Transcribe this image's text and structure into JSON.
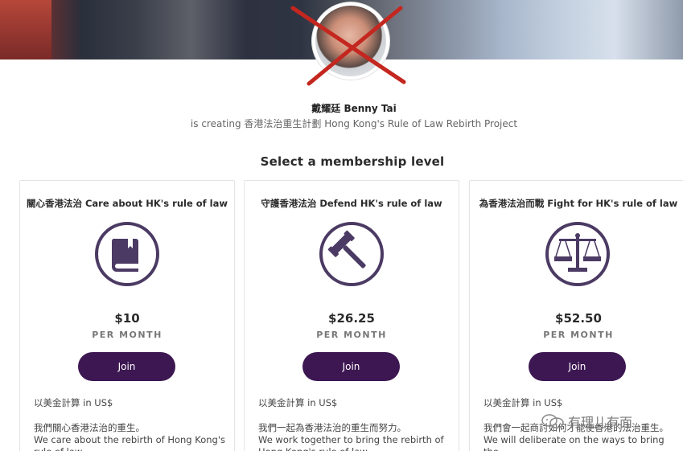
{
  "creator": {
    "name": "戴耀廷 Benny Tai",
    "creating_line": "is creating 香港法治重生計劃 Hong Kong's Rule of Law Rebirth Project"
  },
  "section_title": "Select a membership level",
  "tiers": [
    {
      "title": "關心香港法治 Care about HK's rule of law",
      "icon": "book-icon",
      "price": "$10",
      "period": "PER MONTH",
      "join_label": "Join",
      "currency_note": "以美金計算 in US$",
      "desc_zh": "我們關心香港法治的重生。",
      "desc_en": "We care about the rebirth of Hong Kong's rule of law"
    },
    {
      "title": "守護香港法治 Defend HK's rule of law",
      "icon": "gavel-icon",
      "price": "$26.25",
      "period": "PER MONTH",
      "join_label": "Join",
      "currency_note": "以美金計算 in US$",
      "desc_zh": "我們一起為香港法治的重生而努力。",
      "desc_en": "We work together to bring the rebirth of Hong Kong's rule of law"
    },
    {
      "title": "為香港法治而戰 Fight for HK's rule of law",
      "icon": "scales-icon",
      "price": "$52.50",
      "period": "PER MONTH",
      "join_label": "Join",
      "currency_note": "以美金計算 in US$",
      "desc_zh": "我們會一起商討如何才能使香港的法治重生。",
      "desc_en": "We will deliberate on the ways to bring the"
    }
  ],
  "watermark": "有理儿有面",
  "colors": {
    "accent": "#3d1752",
    "icon": "#4b3a63",
    "cross": "#c4271f"
  }
}
